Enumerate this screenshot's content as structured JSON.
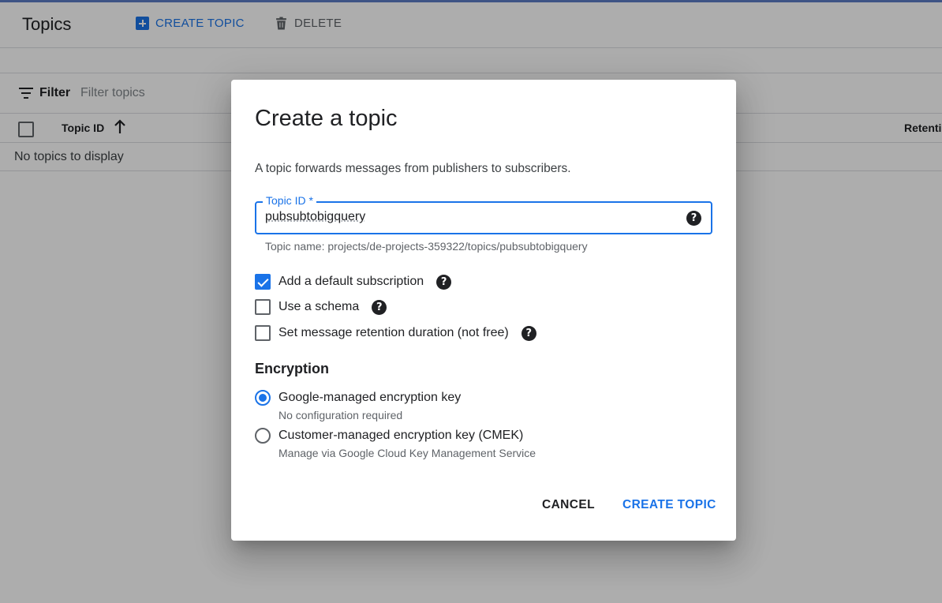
{
  "header": {
    "title": "Topics",
    "create_label": "CREATE TOPIC",
    "delete_label": "DELETE"
  },
  "filter": {
    "label": "Filter",
    "placeholder": "Filter topics"
  },
  "table": {
    "columns": [
      "Topic ID",
      "Retenti"
    ],
    "empty_text": "No topics to display"
  },
  "dialog": {
    "title": "Create a topic",
    "description": "A topic forwards messages from publishers to subscribers.",
    "topic_id_label": "Topic ID *",
    "topic_id_value": "pubsubtobigquery",
    "topic_name_hint": "Topic name: projects/de-projects-359322/topics/pubsubtobigquery",
    "options": [
      {
        "label": "Add a default subscription",
        "checked": true
      },
      {
        "label": "Use a schema",
        "checked": false
      },
      {
        "label": "Set message retention duration (not free)",
        "checked": false
      }
    ],
    "encryption": {
      "title": "Encryption",
      "choices": [
        {
          "label": "Google-managed encryption key",
          "sub": "No configuration required",
          "selected": true
        },
        {
          "label": "Customer-managed encryption key (CMEK)",
          "sub": "Manage via Google Cloud Key Management Service",
          "selected": false
        }
      ]
    },
    "cancel_label": "CANCEL",
    "create_label": "CREATE TOPIC"
  },
  "icons": {
    "help": "?"
  },
  "colors": {
    "accent": "#1a73e8",
    "scrim": "rgba(0,0,0,0.32)"
  }
}
